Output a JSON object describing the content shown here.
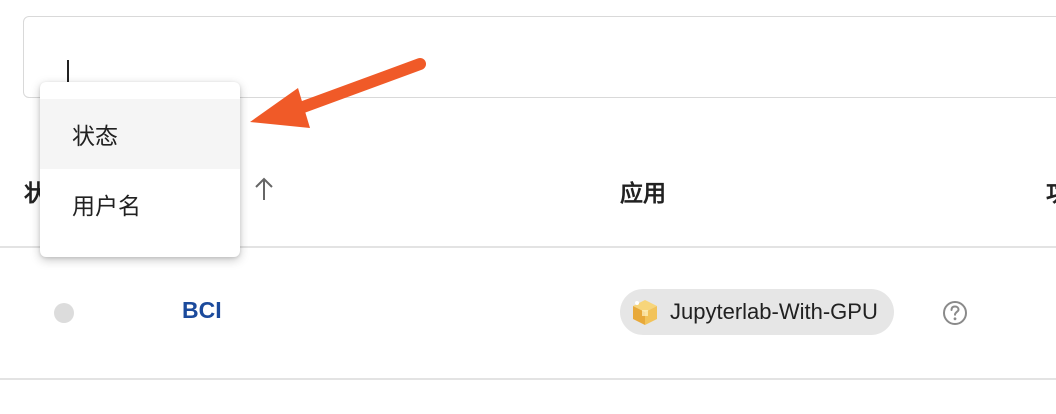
{
  "search": {
    "value": "",
    "placeholder": ""
  },
  "dropdown": {
    "items": [
      {
        "label": "状态"
      },
      {
        "label": "用户名"
      }
    ]
  },
  "table": {
    "headers": {
      "status": "状态",
      "app": "应用",
      "clipped": "功"
    },
    "rows": [
      {
        "status": "inactive",
        "username": "BCI",
        "app": "Jupyterlab-With-GPU"
      }
    ]
  },
  "colors": {
    "annotation_arrow": "#f05a28",
    "link": "#1b4a9c",
    "status_dot": "#dcdcdc",
    "chip_bg": "#e6e6e6"
  },
  "icons": {
    "sort": "arrow-up-icon",
    "app": "package-box-icon",
    "help": "question-circle-icon"
  }
}
